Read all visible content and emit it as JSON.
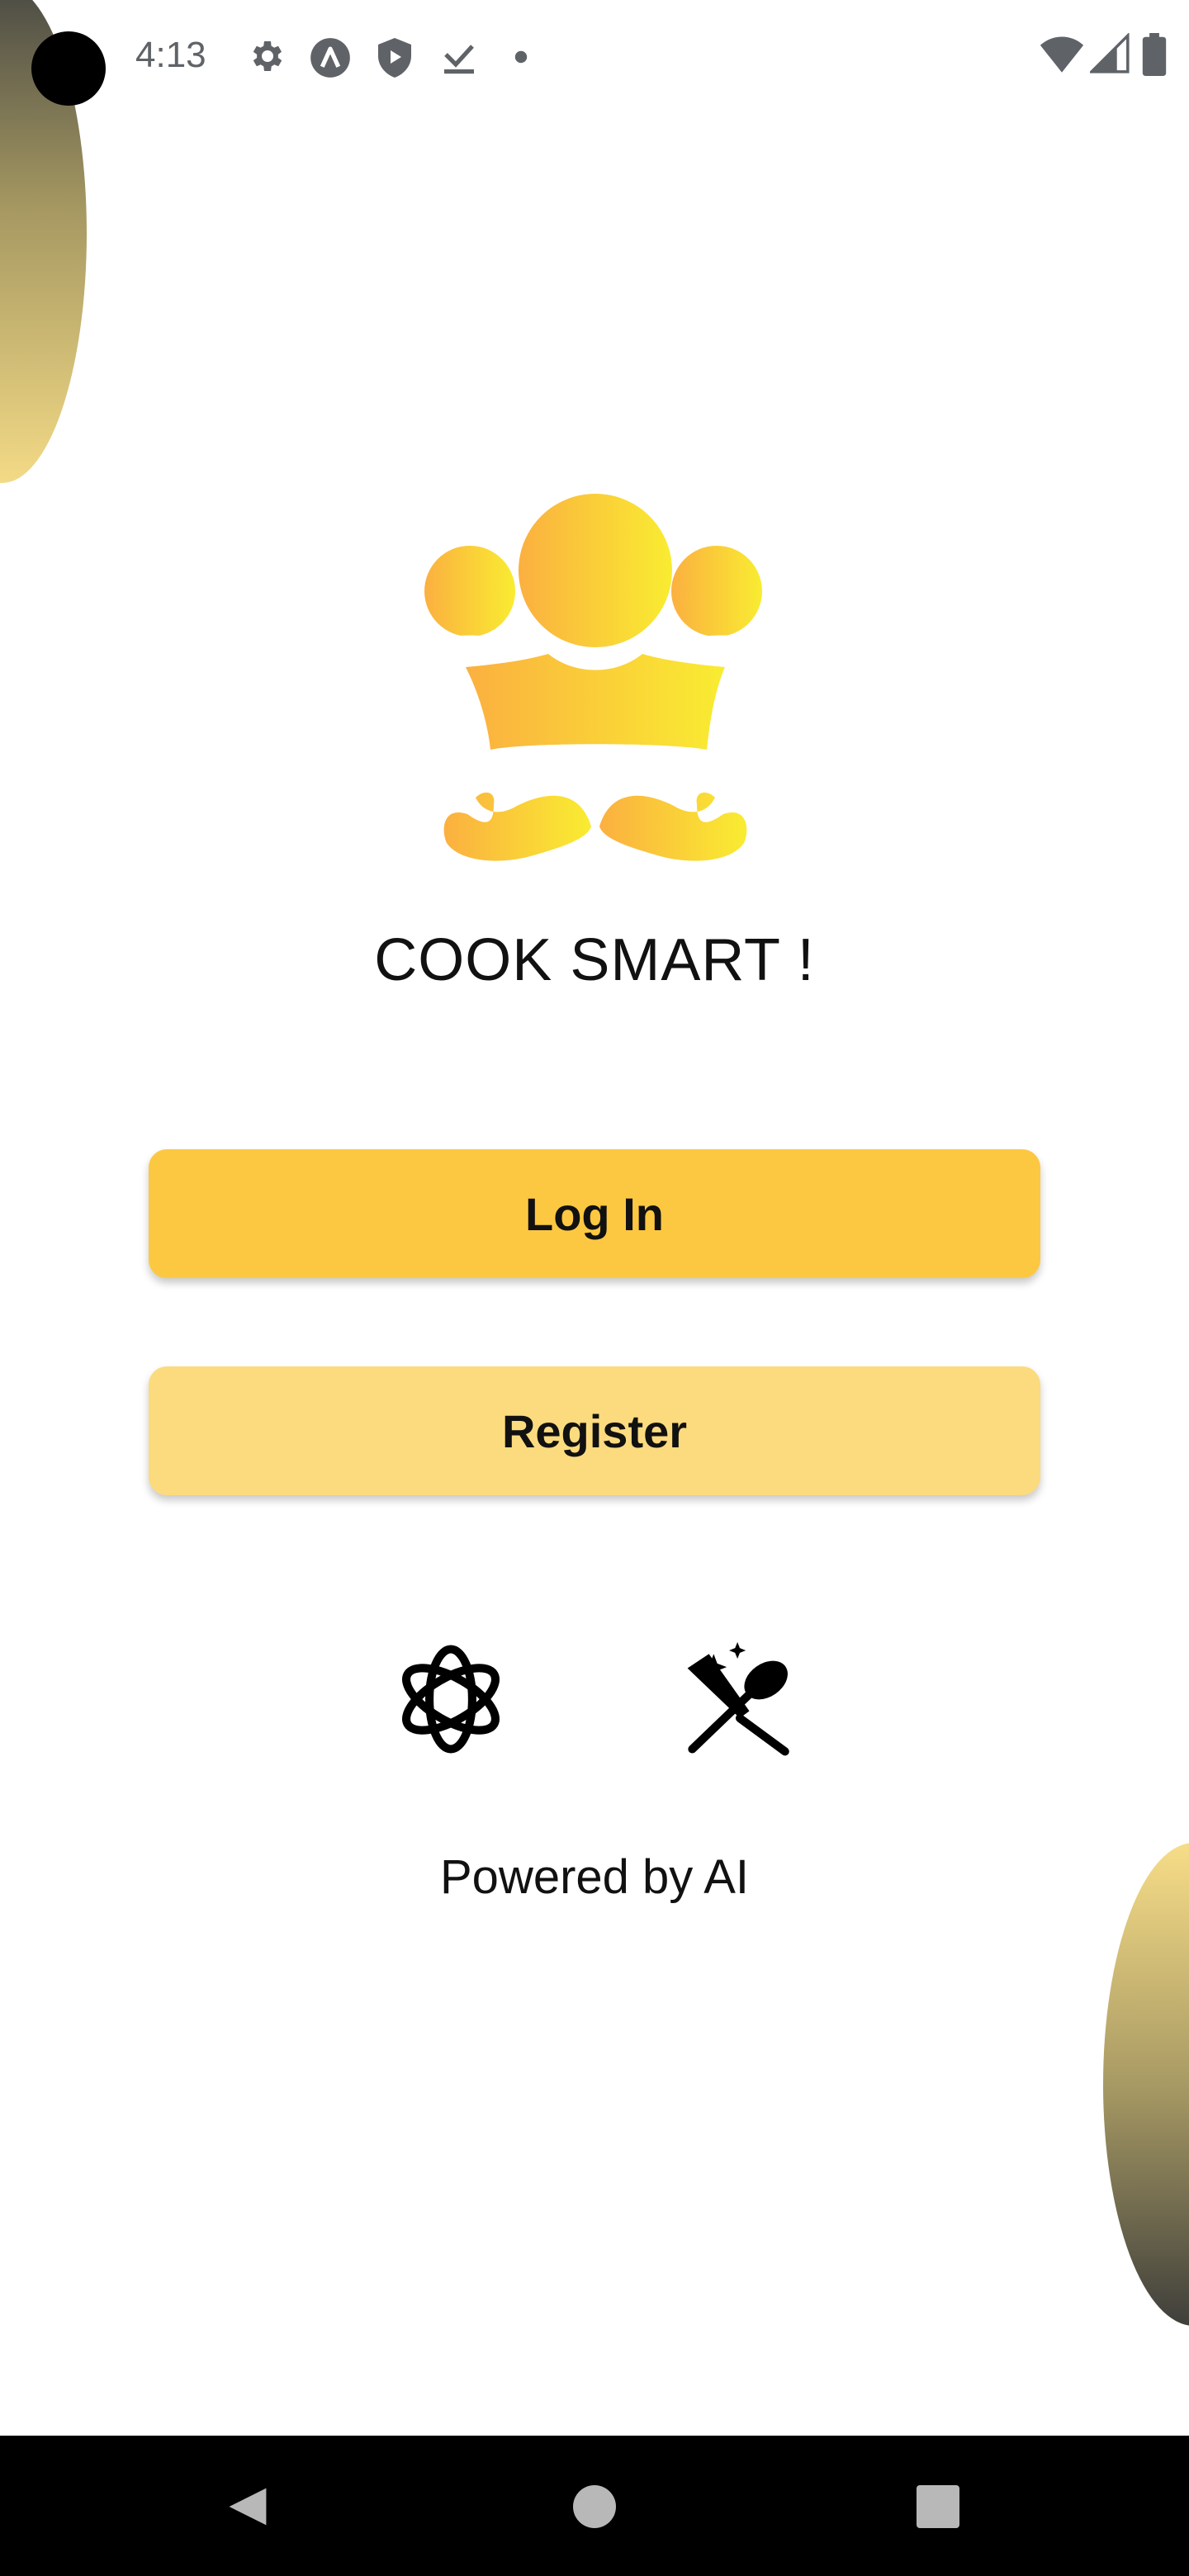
{
  "status_bar": {
    "time": "4:13",
    "left_icons": [
      "gear-icon",
      "app-a-icon",
      "shield-play-icon",
      "download-done-icon",
      "dot-icon"
    ],
    "right_icons": [
      "wifi-icon",
      "signal-icon",
      "battery-icon"
    ]
  },
  "app": {
    "logo": "chef-hat-mustache-logo",
    "title": "COOK SMART !"
  },
  "actions": {
    "login_label": "Log In",
    "register_label": "Register"
  },
  "ai": {
    "icons": [
      "openai-icon",
      "utensils-sparkle-icon"
    ],
    "powered_by": "Powered by AI"
  },
  "colors": {
    "login_button": "#fdc841",
    "register_button": "#fcdb7f",
    "logo_gradient_start": "#fbb040",
    "logo_gradient_end": "#f9ec31"
  },
  "nav_bar": {
    "buttons": [
      "back-icon",
      "home-icon",
      "recents-icon"
    ]
  }
}
